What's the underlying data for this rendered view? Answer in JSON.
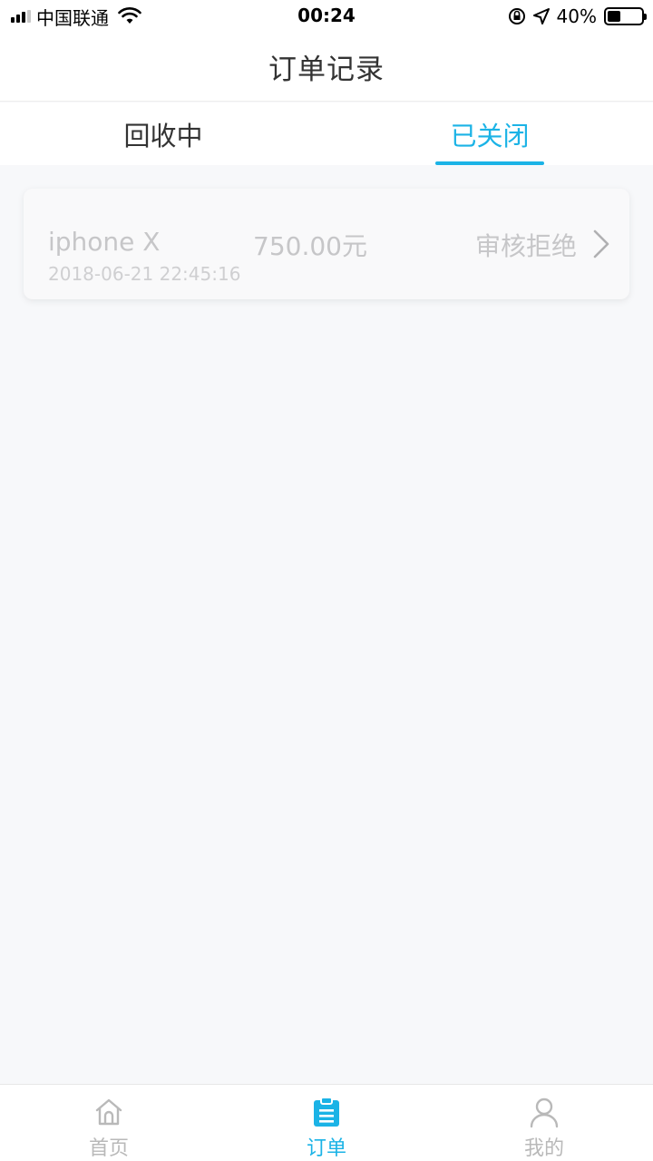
{
  "status_bar": {
    "carrier": "中国联通",
    "time": "00:24",
    "battery_percent": "40%",
    "battery_level": 0.4
  },
  "nav": {
    "title": "订单记录"
  },
  "tabs": [
    {
      "label": "回收中",
      "active": false
    },
    {
      "label": "已关闭",
      "active": true
    }
  ],
  "orders": [
    {
      "name": "iphone X",
      "price": "750.00元",
      "date": "2018-06-21 22:45:16",
      "status": "审核拒绝"
    }
  ],
  "tab_bar": {
    "items": [
      {
        "label": "首页",
        "icon": "home-icon",
        "active": false
      },
      {
        "label": "订单",
        "icon": "order-icon",
        "active": true
      },
      {
        "label": "我的",
        "icon": "user-icon",
        "active": false
      }
    ]
  },
  "colors": {
    "accent": "#1bb3e6",
    "background": "#f7f8fa",
    "muted_text": "#c6c6c8"
  }
}
